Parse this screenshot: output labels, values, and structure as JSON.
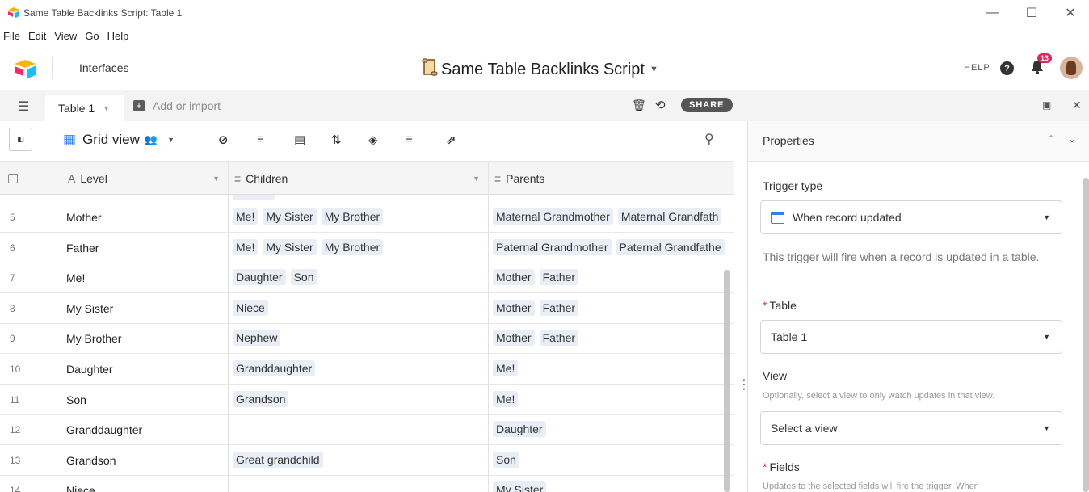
{
  "window": {
    "title": "Same Table Backlinks Script: Table 1",
    "controls": [
      "minimize-icon",
      "maximize-icon",
      "close-icon"
    ]
  },
  "menubar": [
    "File",
    "Edit",
    "View",
    "Go",
    "Help"
  ],
  "appbar": {
    "interfaces_label": "Interfaces",
    "base_title": "Same Table Backlinks Script",
    "help_label": "HELP",
    "help_icon": "?",
    "notification_count": "13"
  },
  "tabsbar": {
    "table_tab": "Table 1",
    "add_or_import": "Add or import",
    "share_label": "SHARE"
  },
  "viewbar": {
    "view_name": "Grid view"
  },
  "grid": {
    "columns": [
      {
        "name": "Level",
        "icon": "A"
      },
      {
        "name": "Children",
        "icon": "≡"
      },
      {
        "name": "Parents",
        "icon": "≡"
      }
    ],
    "rows": [
      {
        "num": "5",
        "level": "Mother",
        "children": [
          "Me!",
          "My Sister",
          "My Brother"
        ],
        "parents": [
          "Maternal Grandmother",
          "Maternal Grandfath"
        ]
      },
      {
        "num": "6",
        "level": "Father",
        "children": [
          "Me!",
          "My Sister",
          "My Brother"
        ],
        "parents": [
          "Paternal Grandmother",
          "Paternal Grandfathe"
        ]
      },
      {
        "num": "7",
        "level": "Me!",
        "children": [
          "Daughter",
          "Son"
        ],
        "parents": [
          "Mother",
          "Father"
        ]
      },
      {
        "num": "8",
        "level": "My Sister",
        "children": [
          "Niece"
        ],
        "parents": [
          "Mother",
          "Father"
        ]
      },
      {
        "num": "9",
        "level": "My Brother",
        "children": [
          "Nephew"
        ],
        "parents": [
          "Mother",
          "Father"
        ]
      },
      {
        "num": "10",
        "level": "Daughter",
        "children": [
          "Granddaughter"
        ],
        "parents": [
          "Me!"
        ]
      },
      {
        "num": "11",
        "level": "Son",
        "children": [
          "Grandson"
        ],
        "parents": [
          "Me!"
        ]
      },
      {
        "num": "12",
        "level": "Granddaughter",
        "children": [],
        "parents": [
          "Daughter"
        ]
      },
      {
        "num": "13",
        "level": "Grandson",
        "children": [
          "Great grandchild"
        ],
        "parents": [
          "Son"
        ]
      },
      {
        "num": "14",
        "level": "Niece",
        "children": [],
        "parents": [
          "My Sister"
        ]
      }
    ]
  },
  "properties": {
    "title": "Properties",
    "trigger_type_label": "Trigger type",
    "trigger_type_value": "When record updated",
    "trigger_desc": "This trigger will fire when a record is updated in a table.",
    "table_label": "Table",
    "table_value": "Table 1",
    "view_label": "View",
    "view_hint": "Optionally, select a view to only watch updates in that view.",
    "view_placeholder": "Select a view",
    "fields_label": "Fields",
    "fields_hint": "Updates to the selected fields will fire the trigger. When"
  }
}
